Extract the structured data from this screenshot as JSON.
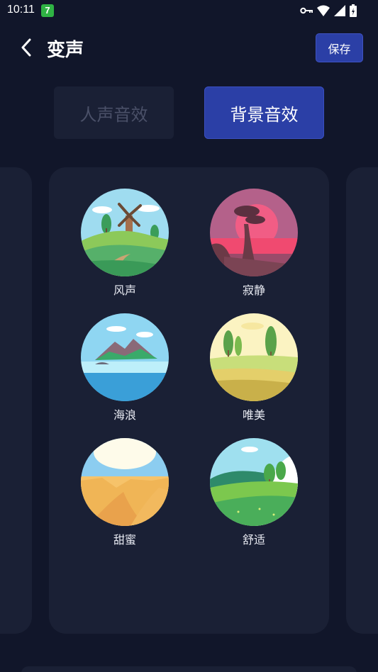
{
  "status_bar": {
    "time": "10:11",
    "app_badge": "7"
  },
  "header": {
    "title": "变声",
    "save_label": "保存"
  },
  "tabs": [
    {
      "label": "人声音效",
      "selected": false
    },
    {
      "label": "背景音效",
      "selected": true
    }
  ],
  "effects": [
    {
      "label": "风声",
      "icon": "windmill-hill-icon"
    },
    {
      "label": "寂静",
      "icon": "silent-sunset-icon"
    },
    {
      "label": "海浪",
      "icon": "island-sea-icon"
    },
    {
      "label": "唯美",
      "icon": "golden-meadow-icon"
    },
    {
      "label": "甜蜜",
      "icon": "desert-dunes-icon"
    },
    {
      "label": "舒适",
      "icon": "green-hills-icon"
    }
  ],
  "colors": {
    "background": "#11162a",
    "panel": "#1a2035",
    "accent": "#2b3fa6"
  }
}
